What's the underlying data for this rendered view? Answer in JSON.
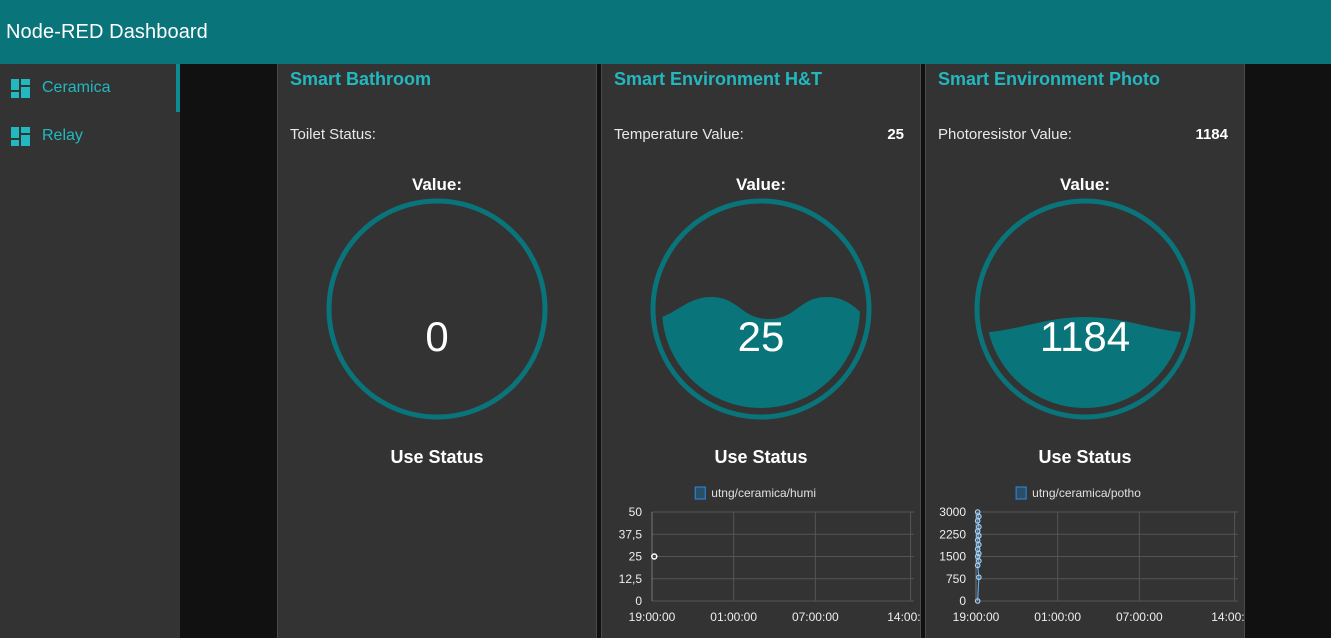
{
  "app": {
    "title": "Node-RED Dashboard"
  },
  "sidebar": {
    "items": [
      {
        "label": "Ceramica",
        "icon": "dashboard-icon",
        "active": true
      },
      {
        "label": "Relay",
        "icon": "dashboard-icon",
        "active": false
      }
    ]
  },
  "colors": {
    "accent": "#097479",
    "link": "#22b8c0",
    "panel": "#333333",
    "background": "#111111"
  },
  "groups": [
    {
      "title": "Smart Bathroom",
      "row_label": "Toilet Status:",
      "row_value": "",
      "gauge_label": "Value:",
      "gauge_value": "0",
      "gauge_fill": 0,
      "status_label": "Use Status"
    },
    {
      "title": "Smart Environment H&T",
      "row_label": "Temperature Value:",
      "row_value": "25",
      "gauge_label": "Value:",
      "gauge_value": "25",
      "gauge_fill": 0.52,
      "status_label": "Use Status",
      "chart_legend": "utng/ceramica/humi"
    },
    {
      "title": "Smart Environment Photo",
      "row_label": "Photoresistor Value:",
      "row_value": "1184",
      "gauge_label": "Value:",
      "gauge_value": "1184",
      "gauge_fill": 0.39,
      "status_label": "Use Status",
      "chart_legend": "utng/ceramica/potho"
    }
  ],
  "chart_data": [
    {
      "type": "line",
      "legend": [
        "utng/ceramica/humi"
      ],
      "ylim": [
        0,
        50
      ],
      "y_ticks": [
        "50",
        "37,5",
        "25",
        "12,5",
        "0"
      ],
      "x_ticks": [
        "19:00:00",
        "01:00:00",
        "07:00:00",
        "14:00:00"
      ],
      "series": [
        {
          "name": "utng/ceramica/humi",
          "points": [
            {
              "x": "19:10:00",
              "y": 25
            }
          ]
        }
      ]
    },
    {
      "type": "line",
      "legend": [
        "utng/ceramica/potho"
      ],
      "ylim": [
        0,
        3000
      ],
      "y_ticks": [
        "3000",
        "2250",
        "1500",
        "750",
        "0"
      ],
      "x_ticks": [
        "19:00:00",
        "01:00:00",
        "07:00:00",
        "14:00:00"
      ],
      "series": [
        {
          "name": "utng/ceramica/potho",
          "values": [
            0,
            800,
            1200,
            1350,
            1500,
            1600,
            1750,
            1900,
            2050,
            2200,
            2350,
            2500,
            2700,
            2850,
            3000
          ]
        }
      ]
    }
  ]
}
